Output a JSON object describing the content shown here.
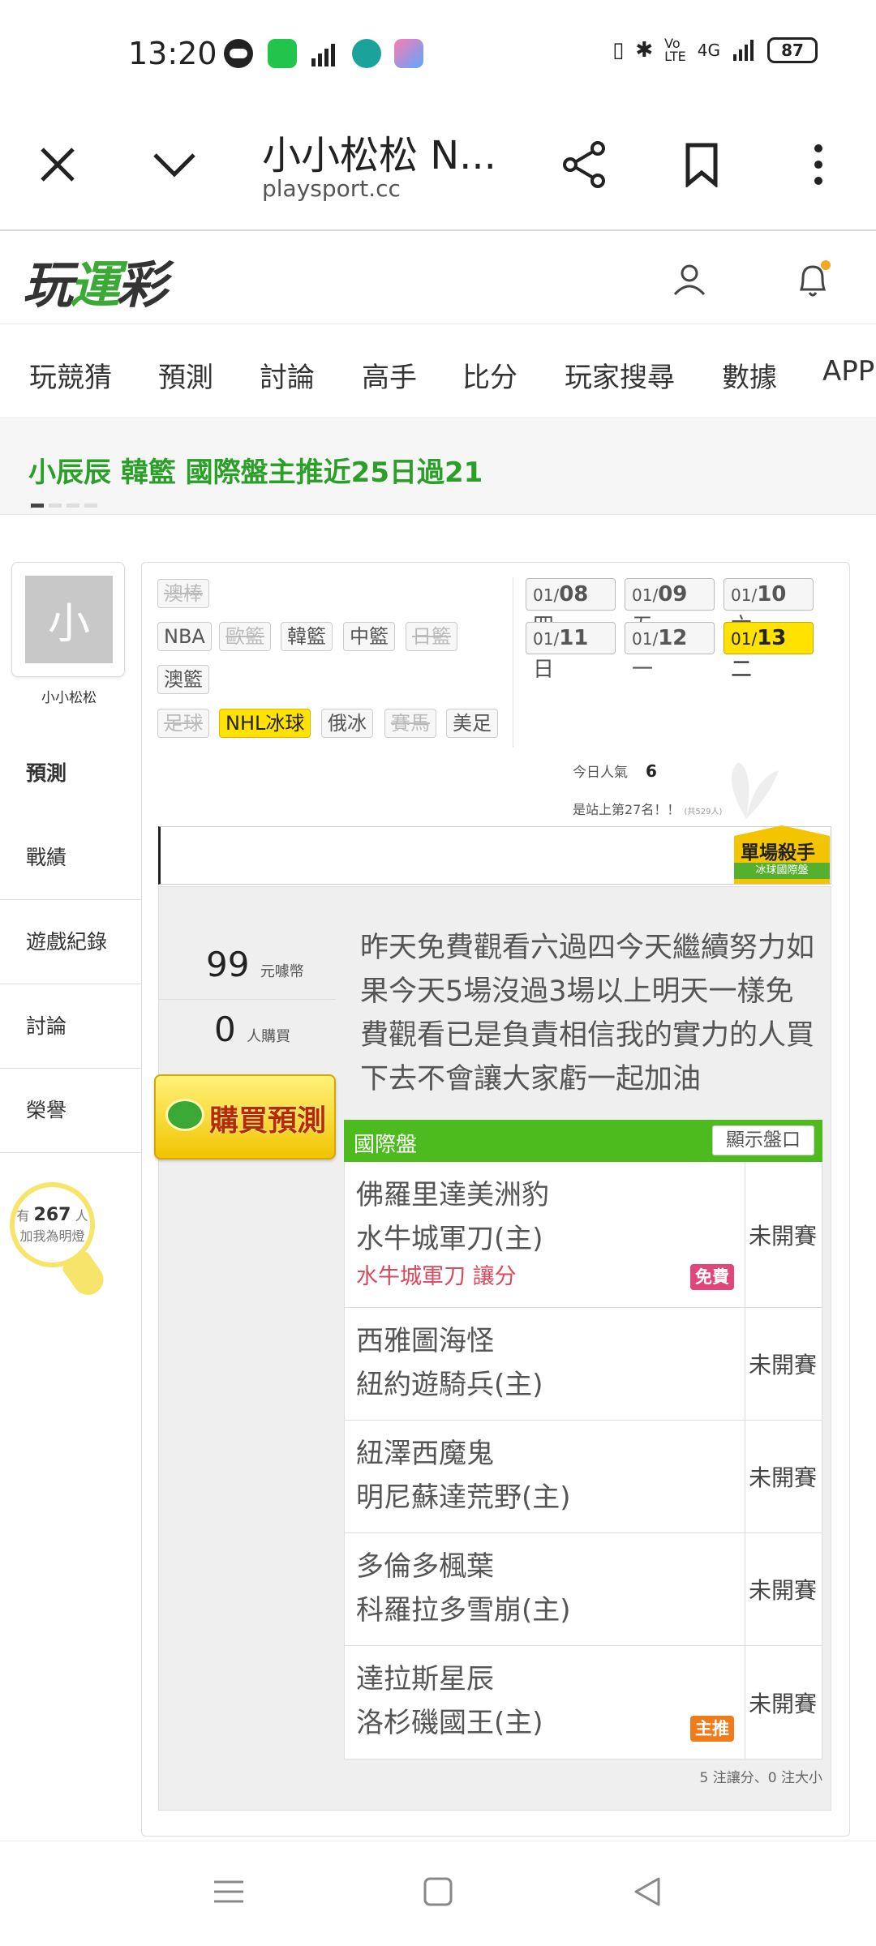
{
  "status": {
    "time": "13:20",
    "network": "4G",
    "battery": "87",
    "app_icons": [
      "line-icon",
      "wechat-icon",
      "signal-chart-icon",
      "mountain-app-icon",
      "game-app-icon"
    ]
  },
  "browser": {
    "title": "小小松松 N...",
    "url": "playsport.cc"
  },
  "site": {
    "logo_text": "玩運彩",
    "nav": [
      "玩競猜",
      "預測",
      "討論",
      "高手",
      "比分",
      "玩家搜尋",
      "數據",
      "APP"
    ],
    "ticker": "小辰辰  韓籃 國際盤主推近25日過21"
  },
  "user": {
    "avatar_char": "小",
    "name": "小小松松",
    "menu": [
      "預測",
      "戰績",
      "遊戲紀錄",
      "討論",
      "榮譽"
    ],
    "followers_prefix": "有",
    "followers_count": "267",
    "followers_suffix": "人",
    "followers_note": "加我為明燈"
  },
  "leagues": [
    {
      "label": "澳棒",
      "state": "disabled"
    },
    {
      "label": "NBA",
      "state": "normal"
    },
    {
      "label": "歐籃",
      "state": "disabled"
    },
    {
      "label": "韓籃",
      "state": "normal"
    },
    {
      "label": "中籃",
      "state": "normal"
    },
    {
      "label": "日籃",
      "state": "disabled"
    },
    {
      "label": "澳籃",
      "state": "normal"
    },
    {
      "label": "足球",
      "state": "disabled"
    },
    {
      "label": "NHL冰球",
      "state": "selected"
    },
    {
      "label": "俄冰",
      "state": "normal"
    },
    {
      "label": "賽馬",
      "state": "disabled"
    },
    {
      "label": "美足",
      "state": "normal"
    }
  ],
  "dates": [
    {
      "md": "01/",
      "day": "08",
      "wd": "四",
      "selected": false
    },
    {
      "md": "01/",
      "day": "09",
      "wd": "五",
      "selected": false
    },
    {
      "md": "01/",
      "day": "10",
      "wd": "六",
      "selected": false
    },
    {
      "md": "01/",
      "day": "11",
      "wd": "日",
      "selected": false
    },
    {
      "md": "01/",
      "day": "12",
      "wd": "一",
      "selected": false
    },
    {
      "md": "01/",
      "day": "13",
      "wd": "二",
      "selected": true
    }
  ],
  "popularity": {
    "label": "今日人氣",
    "value": "6",
    "rank_text": "是站上第27名！！",
    "rank_total": "(共529人)"
  },
  "badge_killer": {
    "title": "單場殺手",
    "sub": "冰球國際盤"
  },
  "sale": {
    "price": "99",
    "price_unit": "元噱幣",
    "buyers": "0",
    "buyers_unit": "人購買",
    "buy_button": "購買預測"
  },
  "description": "昨天免費觀看六過四今天繼續努力如果今天5場沒過3場以上明天一樣免費觀看已是負責相信我的實力的人買下去不會讓大家虧一起加油",
  "odds": {
    "header": "國際盤",
    "toggle": "顯示盤口",
    "games": [
      {
        "away": "佛羅里達美洲豹",
        "home": "水牛城軍刀(主)",
        "pick": "水牛城軍刀 讓分",
        "badge": "免費",
        "status": "未開賽"
      },
      {
        "away": "西雅圖海怪",
        "home": "紐約遊騎兵(主)",
        "pick": "",
        "badge": "",
        "status": "未開賽"
      },
      {
        "away": "紐澤西魔鬼",
        "home": "明尼蘇達荒野(主)",
        "pick": "",
        "badge": "",
        "status": "未開賽"
      },
      {
        "away": "多倫多楓葉",
        "home": "科羅拉多雪崩(主)",
        "pick": "",
        "badge": "",
        "status": "未開賽"
      },
      {
        "away": "達拉斯星辰",
        "home": "洛杉磯國王(主)",
        "pick": "",
        "badge": "主推",
        "status": "未開賽"
      }
    ],
    "summary": "5 注讓分、0 注大小"
  },
  "colors": {
    "brand_green": "#3aa935",
    "highlight_yellow": "#ffe200",
    "pick_red": "#d94a5c",
    "free_pink": "#e0457b",
    "main_orange": "#f07b1a"
  }
}
